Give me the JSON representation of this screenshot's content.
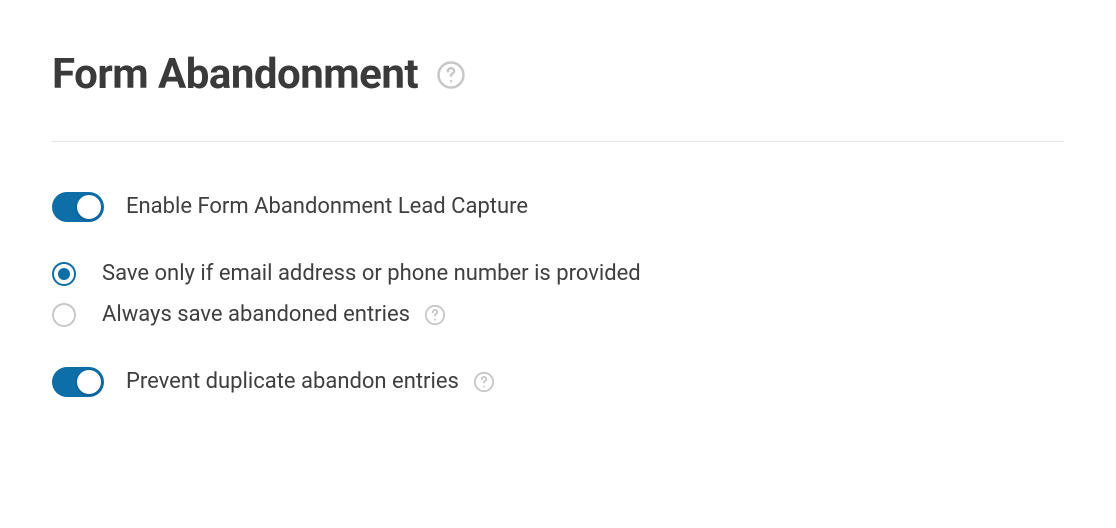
{
  "heading": {
    "title": "Form Abandonment"
  },
  "settings": {
    "enable_capture": {
      "label": "Enable Form Abandonment Lead Capture",
      "on": true
    },
    "save_rule": {
      "options": [
        {
          "label": "Save only if email address or phone number is provided",
          "selected": true,
          "has_help": false
        },
        {
          "label": "Always save abandoned entries",
          "selected": false,
          "has_help": true
        }
      ]
    },
    "prevent_duplicate": {
      "label": "Prevent duplicate abandon entries",
      "on": true
    }
  }
}
